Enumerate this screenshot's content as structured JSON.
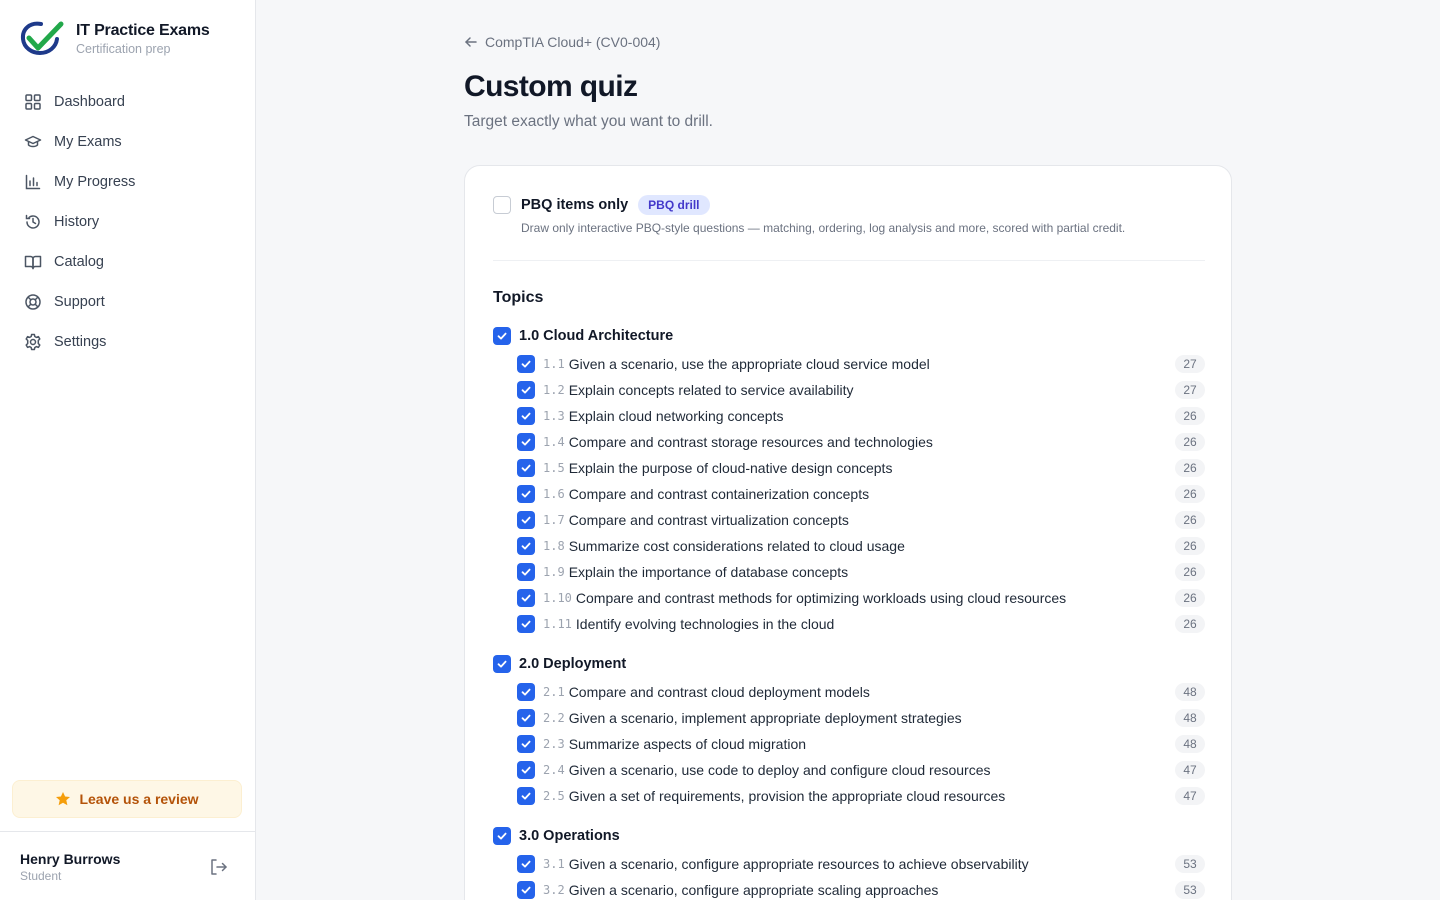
{
  "brand": {
    "title": "IT Practice Exams",
    "subtitle": "Certification prep"
  },
  "nav": [
    {
      "label": "Dashboard",
      "icon": "dashboard-icon"
    },
    {
      "label": "My Exams",
      "icon": "graduation-cap-icon"
    },
    {
      "label": "My Progress",
      "icon": "bar-chart-icon"
    },
    {
      "label": "History",
      "icon": "history-icon"
    },
    {
      "label": "Catalog",
      "icon": "book-icon"
    },
    {
      "label": "Support",
      "icon": "lifebuoy-icon"
    },
    {
      "label": "Settings",
      "icon": "gear-icon"
    }
  ],
  "review_button": {
    "label": "Leave us a review",
    "icon": "star-icon"
  },
  "user": {
    "name": "Henry Burrows",
    "role": "Student"
  },
  "breadcrumb": {
    "back_label": "CompTIA Cloud+ (CV0-004)"
  },
  "page": {
    "title": "Custom quiz",
    "subtitle": "Target exactly what you want to drill."
  },
  "pbq": {
    "label": "PBQ items only",
    "badge": "PBQ drill",
    "description": "Draw only interactive PBQ-style questions — matching, ordering, log analysis and more, scored with partial credit.",
    "checked": false
  },
  "topics": {
    "title": "Topics",
    "domains": [
      {
        "label": "1.0 Cloud Architecture",
        "checked": true,
        "objectives": [
          {
            "code": "1.1",
            "label": "Given a scenario, use the appropriate cloud service model",
            "count": "27"
          },
          {
            "code": "1.2",
            "label": "Explain concepts related to service availability",
            "count": "27"
          },
          {
            "code": "1.3",
            "label": "Explain cloud networking concepts",
            "count": "26"
          },
          {
            "code": "1.4",
            "label": "Compare and contrast storage resources and technologies",
            "count": "26"
          },
          {
            "code": "1.5",
            "label": "Explain the purpose of cloud-native design concepts",
            "count": "26"
          },
          {
            "code": "1.6",
            "label": "Compare and contrast containerization concepts",
            "count": "26"
          },
          {
            "code": "1.7",
            "label": "Compare and contrast virtualization concepts",
            "count": "26"
          },
          {
            "code": "1.8",
            "label": "Summarize cost considerations related to cloud usage",
            "count": "26"
          },
          {
            "code": "1.9",
            "label": "Explain the importance of database concepts",
            "count": "26"
          },
          {
            "code": "1.10",
            "label": "Compare and contrast methods for optimizing workloads using cloud resources",
            "count": "26"
          },
          {
            "code": "1.11",
            "label": "Identify evolving technologies in the cloud",
            "count": "26"
          }
        ]
      },
      {
        "label": "2.0 Deployment",
        "checked": true,
        "objectives": [
          {
            "code": "2.1",
            "label": "Compare and contrast cloud deployment models",
            "count": "48"
          },
          {
            "code": "2.2",
            "label": "Given a scenario, implement appropriate deployment strategies",
            "count": "48"
          },
          {
            "code": "2.3",
            "label": "Summarize aspects of cloud migration",
            "count": "48"
          },
          {
            "code": "2.4",
            "label": "Given a scenario, use code to deploy and configure cloud resources",
            "count": "47"
          },
          {
            "code": "2.5",
            "label": "Given a set of requirements, provision the appropriate cloud resources",
            "count": "47"
          }
        ]
      },
      {
        "label": "3.0 Operations",
        "checked": true,
        "objectives": [
          {
            "code": "3.1",
            "label": "Given a scenario, configure appropriate resources to achieve observability",
            "count": "53"
          },
          {
            "code": "3.2",
            "label": "Given a scenario, configure appropriate scaling approaches",
            "count": "53"
          }
        ]
      }
    ]
  },
  "colors": {
    "accent": "#2563eb",
    "badge_bg": "#e0e7ff",
    "badge_text": "#4338ca",
    "review_text": "#b45309"
  }
}
